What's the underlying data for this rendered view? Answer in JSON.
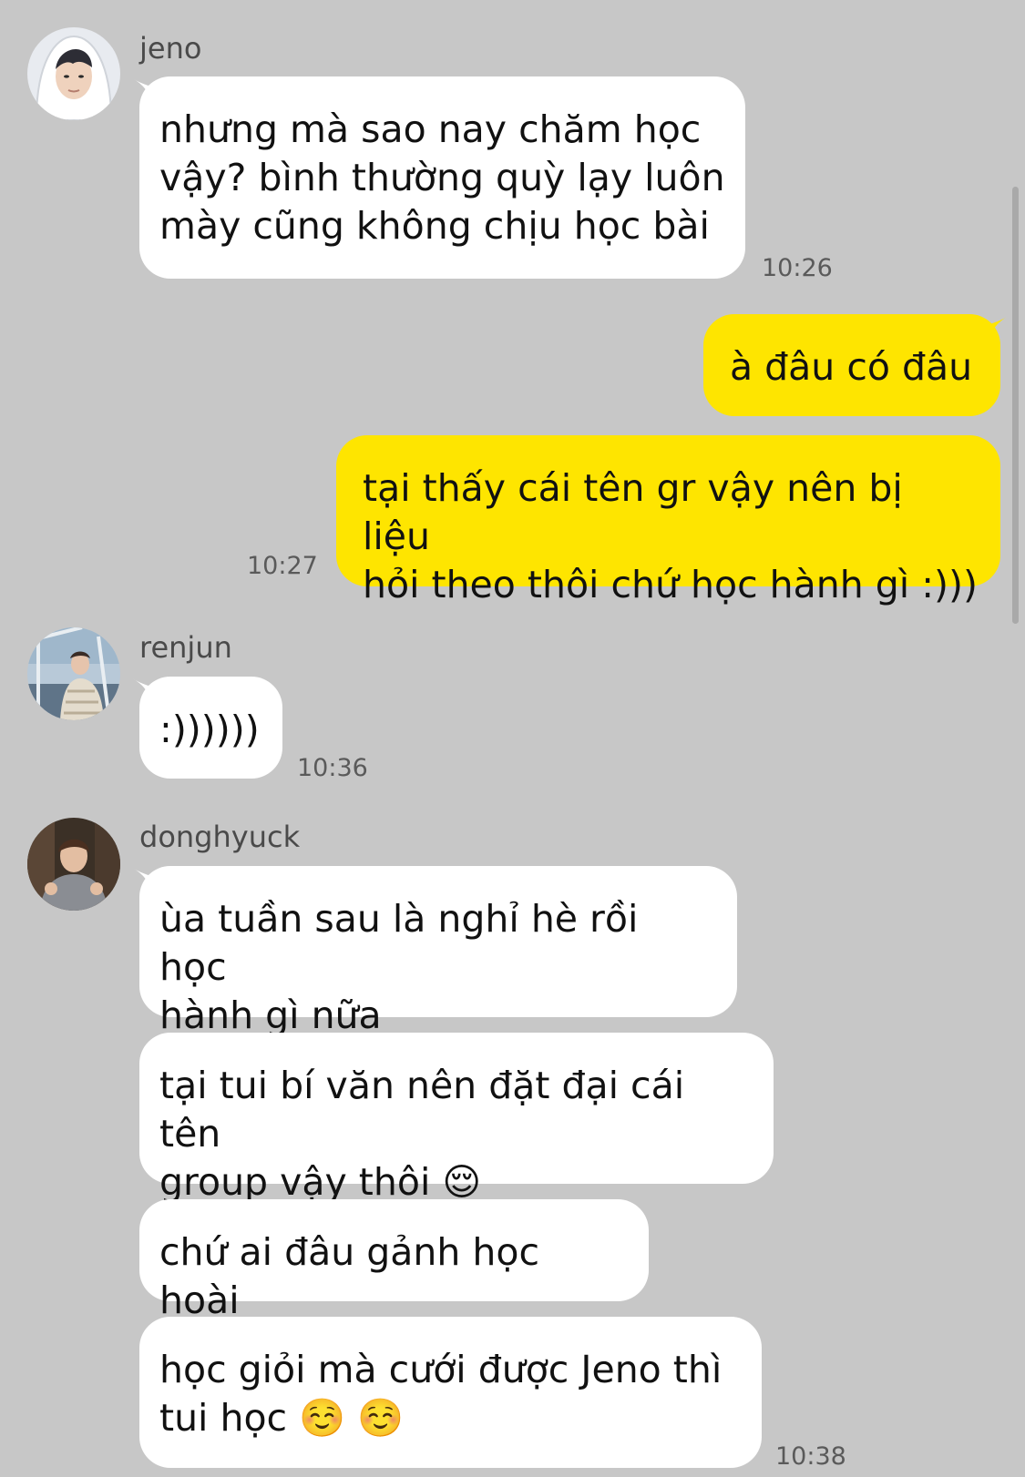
{
  "colors": {
    "background": "#c7c7c7",
    "incoming_bubble": "#ffffff",
    "outgoing_bubble": "#fee500",
    "timestamp": "#5a5a5a"
  },
  "messages": {
    "jeno": {
      "sender": "jeno",
      "avatar_icon": "profile-photo-icon",
      "text": "nhưng mà sao nay chăm học\nvậy? bình thường quỳ lạy luôn\nmày cũng không chịu học bài",
      "time": "10:26"
    },
    "me": {
      "text_1": "à đâu có đâu",
      "text_2": "tại thấy cái tên gr vậy nên bị liệu\nhỏi theo thôi chứ học hành gì :)))",
      "time": "10:27"
    },
    "renjun": {
      "sender": "renjun",
      "avatar_icon": "profile-photo-icon",
      "text": ":))))))",
      "time": "10:36"
    },
    "donghyuck": {
      "sender": "donghyuck",
      "avatar_icon": "profile-photo-icon",
      "text_1": "ùa tuần sau là nghỉ hè rồi học\nhành gì nữa",
      "text_2": "tại tui bí văn nên đặt đại cái tên\ngroup vậy thôi 😌",
      "text_3": "chứ ai đâu gảnh học hoài",
      "text_4": "học giỏi mà cưới được Jeno thì\ntui học ☺️ ☺️",
      "time": "10:38"
    }
  }
}
